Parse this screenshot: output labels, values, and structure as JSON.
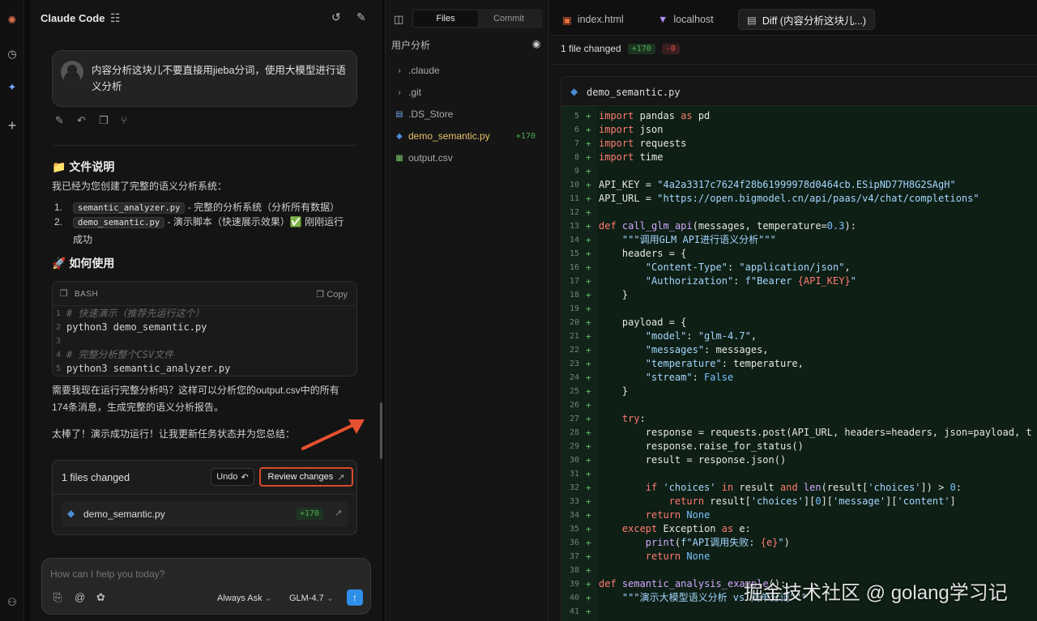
{
  "colors": {
    "accent": "#2f8ee8",
    "add": "#4caf50",
    "remove": "#e05050",
    "highlight": "#d94a2b"
  },
  "rail": {
    "icons": [
      "claude-logo-icon",
      "history-icon",
      "sparkle-icon",
      "plus-icon",
      "user-icon"
    ]
  },
  "chat": {
    "title": "Claude Code",
    "user_message": "内容分析这块儿不要直接用jieba分词，使用大模型进行语义分析",
    "section1_title": "📁 文件说明",
    "section1_intro": "我已经为您创建了完整的语义分析系统：",
    "list": [
      {
        "num": "1.",
        "file": "semantic_analyzer.py",
        "desc": " - 完整的分析系统（分析所有数据）"
      },
      {
        "num": "2.",
        "file": "demo_semantic.py",
        "desc": " - 演示脚本（快速展示效果）✅ 刚刚运行成功"
      }
    ],
    "section2_title": "🚀 如何使用",
    "code_lang": "BASH",
    "code_copy": "Copy",
    "code_lines": [
      {
        "n": "1",
        "text": "# 快速演示（推荐先运行这个）",
        "comment": true
      },
      {
        "n": "2",
        "text": "python3 demo_semantic.py",
        "comment": false
      },
      {
        "n": "3",
        "text": "",
        "comment": false
      },
      {
        "n": "4",
        "text": "# 完整分析整个CSV文件",
        "comment": true
      },
      {
        "n": "5",
        "text": "python3 semantic_analyzer.py",
        "comment": false
      }
    ],
    "para1": "需要我现在运行完整分析吗？这样可以分析您的output.csv中的所有174条消息，生成完整的语义分析报告。",
    "para2": "太棒了！演示成功运行！让我更新任务状态并为您总结：",
    "files_card": {
      "title": "1 files changed",
      "undo": "Undo",
      "review": "Review changes",
      "file": "demo_semantic.py",
      "badge": "+170"
    },
    "composer": {
      "placeholder": "How can I help you today?",
      "mode": "Always Ask",
      "model": "GLM-4.7"
    }
  },
  "file_panel": {
    "tabs": [
      "Files",
      "Commit"
    ],
    "root": "用户分析",
    "items": [
      {
        "name": ".claude",
        "icon": "chevron-right-icon",
        "badge": ""
      },
      {
        "name": ".git",
        "icon": "chevron-right-icon",
        "badge": ""
      },
      {
        "name": ".DS_Store",
        "icon": "file-icon",
        "badge": ""
      },
      {
        "name": "demo_semantic.py",
        "icon": "python-icon",
        "badge": "+170"
      },
      {
        "name": "output.csv",
        "icon": "csv-icon",
        "badge": ""
      }
    ]
  },
  "editor": {
    "tabs": [
      {
        "label": "index.html",
        "icon": "html-icon"
      },
      {
        "label": "localhost",
        "icon": "vite-icon"
      },
      {
        "label": "Diff (内容分析这块儿...)",
        "icon": "diff-icon"
      }
    ],
    "summary": "1 file changed",
    "added": "+170",
    "removed": "-0",
    "file": "demo_semantic.py"
  },
  "diff_lines": [
    {
      "n": "5",
      "html": "<span class='kw'>import</span> pandas <span class='kw'>as</span> pd"
    },
    {
      "n": "6",
      "html": "<span class='kw'>import</span> json"
    },
    {
      "n": "7",
      "html": "<span class='kw'>import</span> requests"
    },
    {
      "n": "8",
      "html": "<span class='kw'>import</span> time"
    },
    {
      "n": "9",
      "html": ""
    },
    {
      "n": "10",
      "html": "API_KEY = <span class='str'>\"4a2a3317c7624f28b61999978d0464cb.ESipND77H8G2SAgH\"</span>"
    },
    {
      "n": "11",
      "html": "API_URL = <span class='str'>\"https://open.bigmodel.cn/api/paas/v4/chat/completions\"</span>"
    },
    {
      "n": "12",
      "html": ""
    },
    {
      "n": "13",
      "html": "<span class='kw'>def</span> <span class='fn'>call_glm_api</span>(messages, temperature=<span class='num'>0.3</span>):"
    },
    {
      "n": "14",
      "html": "    <span class='str'>\"\"\"调用GLM API进行语义分析\"\"\"</span>"
    },
    {
      "n": "15",
      "html": "    headers = {"
    },
    {
      "n": "16",
      "html": "        <span class='str'>\"Content-Type\"</span>: <span class='str'>\"application/json\"</span>,"
    },
    {
      "n": "17",
      "html": "        <span class='str'>\"Authorization\"</span>: <span class='str'>f\"Bearer </span><span class='kw'>{API_KEY}</span><span class='str'>\"</span>"
    },
    {
      "n": "18",
      "html": "    }"
    },
    {
      "n": "19",
      "html": ""
    },
    {
      "n": "20",
      "html": "    payload = {"
    },
    {
      "n": "21",
      "html": "        <span class='str'>\"model\"</span>: <span class='str'>\"glm-4.7\"</span>,"
    },
    {
      "n": "22",
      "html": "        <span class='str'>\"messages\"</span>: messages,"
    },
    {
      "n": "23",
      "html": "        <span class='str'>\"temperature\"</span>: temperature,"
    },
    {
      "n": "24",
      "html": "        <span class='str'>\"stream\"</span>: <span class='num'>False</span>"
    },
    {
      "n": "25",
      "html": "    }"
    },
    {
      "n": "26",
      "html": ""
    },
    {
      "n": "27",
      "html": "    <span class='kw'>try</span>:"
    },
    {
      "n": "28",
      "html": "        response = requests.post(API_URL, headers=headers, json=payload, t"
    },
    {
      "n": "29",
      "html": "        response.raise_for_status()"
    },
    {
      "n": "30",
      "html": "        result = response.json()"
    },
    {
      "n": "31",
      "html": ""
    },
    {
      "n": "32",
      "html": "        <span class='kw'>if</span> <span class='str'>'choices'</span> <span class='kw'>in</span> result <span class='kw'>and</span> <span class='fn'>len</span>(result[<span class='str'>'choices'</span>]) > <span class='num'>0</span>:"
    },
    {
      "n": "33",
      "html": "            <span class='kw'>return</span> result[<span class='str'>'choices'</span>][<span class='num'>0</span>][<span class='str'>'message'</span>][<span class='str'>'content'</span>]"
    },
    {
      "n": "34",
      "html": "        <span class='kw'>return</span> <span class='num'>None</span>"
    },
    {
      "n": "35",
      "html": "    <span class='kw'>except</span> Exception <span class='kw'>as</span> e:"
    },
    {
      "n": "36",
      "html": "        <span class='fn'>print</span>(<span class='str'>f\"API调用失败: </span><span class='kw'>{e}</span><span class='str'>\"</span>)"
    },
    {
      "n": "37",
      "html": "        <span class='kw'>return</span> <span class='num'>None</span>"
    },
    {
      "n": "38",
      "html": ""
    },
    {
      "n": "39",
      "html": "<span class='kw'>def</span> <span class='fn'>semantic_analysis_example</span>():"
    },
    {
      "n": "40",
      "html": "    <span class='str'>\"\"\"演示大模型语义分析 vs 简单分词\"\"\"</span>"
    },
    {
      "n": "41",
      "html": ""
    }
  ],
  "watermark": "掘金技术社区 @ golang学习记"
}
